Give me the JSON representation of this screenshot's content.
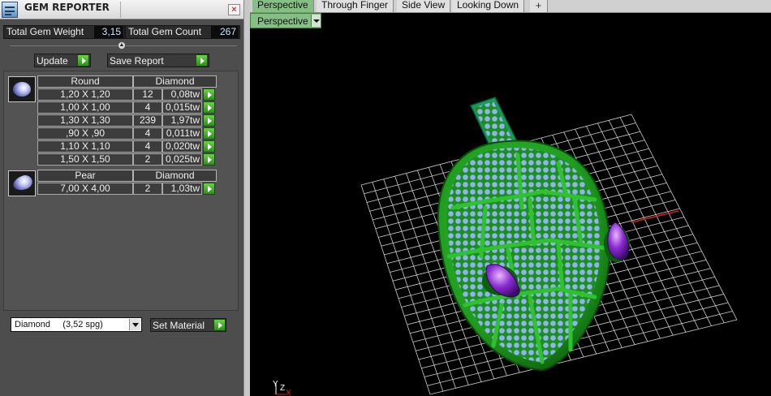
{
  "panel": {
    "title": "GEM REPORTER",
    "close_icon": "×",
    "stats": {
      "weight_label": "Total Gem Weight",
      "weight_value": "3,15",
      "count_label": "Total Gem Count",
      "count_value": "267"
    },
    "update_label": "Update",
    "save_report_label": "Save Report",
    "groups": [
      {
        "shape": "Round",
        "material": "Diamond",
        "rows": [
          {
            "size": "1,20 X 1,20",
            "count": "12",
            "weight": "0,08tw"
          },
          {
            "size": "1,00 X 1,00",
            "count": "4",
            "weight": "0,015tw"
          },
          {
            "size": "1,30 X 1,30",
            "count": "239",
            "weight": "1,97tw"
          },
          {
            "size": ",90 X ,90",
            "count": "4",
            "weight": "0,011tw"
          },
          {
            "size": "1,10 X 1,10",
            "count": "4",
            "weight": "0,020tw"
          },
          {
            "size": "1,50 X 1,50",
            "count": "2",
            "weight": "0,025tw"
          }
        ]
      },
      {
        "shape": "Pear",
        "material": "Diamond",
        "rows": [
          {
            "size": "7,00 X 4,00",
            "count": "2",
            "weight": "1,03tw"
          }
        ]
      }
    ],
    "material_select": "Diamond     (3,52 spg)",
    "set_material_label": "Set Material"
  },
  "tabs": [
    {
      "label": "Perspective",
      "active": true
    },
    {
      "label": "Through Finger",
      "active": false
    },
    {
      "label": "Side View",
      "active": false
    },
    {
      "label": "Looking Down",
      "active": false
    }
  ],
  "tab_add_icon": "+",
  "viewport": {
    "view_dropdown": "Perspective",
    "axis_labels": {
      "y": "Y",
      "z": "Z",
      "x": "X"
    }
  },
  "colors": {
    "model_green": "#1f9c1f",
    "gem_blue": "#8fb3f0",
    "pear_purple": "#8a2bd0",
    "grid": "#cfcfcf",
    "active_tab": "#84c084"
  }
}
